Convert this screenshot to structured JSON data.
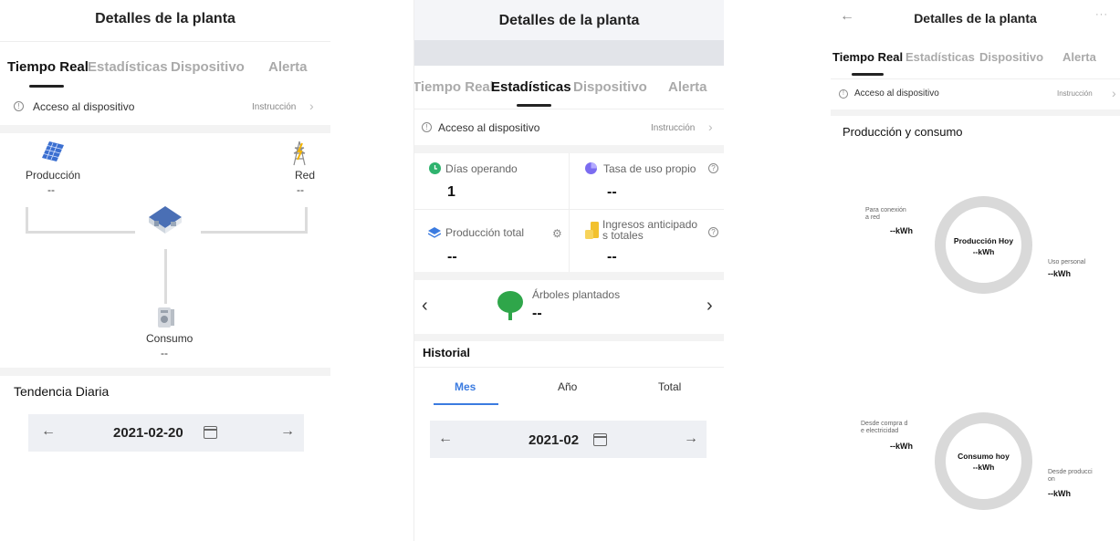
{
  "panel1": {
    "title": "Detalles de la planta",
    "tabs": [
      "Tiempo Real",
      "Estadísticas",
      "Dispositivo",
      "Alerta"
    ],
    "access_label": "Acceso al dispositivo",
    "instruction": "Instrucción",
    "production_label": "Producción",
    "production_value": "--",
    "grid_label": "Red",
    "grid_value": "--",
    "consumption_label": "Consumo",
    "consumption_value": "--",
    "trend_title": "Tendencia Diaria",
    "date": "2021-02-20"
  },
  "panel2": {
    "title": "Detalles de la planta",
    "tabs": [
      "Tiempo Real",
      "Estadísticas",
      "Dispositivo",
      "Alerta"
    ],
    "access_label": "Acceso al dispositivo",
    "instruction": "Instrucción",
    "days_label": "Días operando",
    "days_value": "1",
    "self_use_label": "Tasa de uso propio",
    "self_use_value": "--",
    "total_prod_label": "Producción total",
    "total_prod_value": "--",
    "income_label_1": "Ingresos anticipado",
    "income_label_2": "s totales",
    "income_value": "--",
    "trees_label": "Árboles plantados",
    "trees_value": "--",
    "history_title": "Historial",
    "history_tabs": [
      "Mes",
      "Año",
      "Total"
    ],
    "date": "2021-02"
  },
  "panel3": {
    "title": "Detalles de la planta",
    "tabs": [
      "Tiempo Real",
      "Estadísticas",
      "Dispositivo",
      "Alerta"
    ],
    "access_label": "Acceso al dispositivo",
    "instruction": "Instrucción",
    "section_title": "Producción y consumo",
    "prod_center_label": "Producción Hoy",
    "prod_center_value": "--kWh",
    "grid_conn_label_1": "Para conexión",
    "grid_conn_label_2": "a red",
    "grid_conn_value": "--kWh",
    "personal_label": "Uso personal",
    "personal_value": "--kWh",
    "cons_center_label": "Consumo hoy",
    "cons_center_value": "--kWh",
    "from_purchase_label_1": "Desde compra d",
    "from_purchase_label_2": "e electricidad",
    "from_purchase_value": "--kWh",
    "from_prod_label_1": "Desde producci",
    "from_prod_label_2": "on",
    "from_prod_value": "--kWh"
  }
}
